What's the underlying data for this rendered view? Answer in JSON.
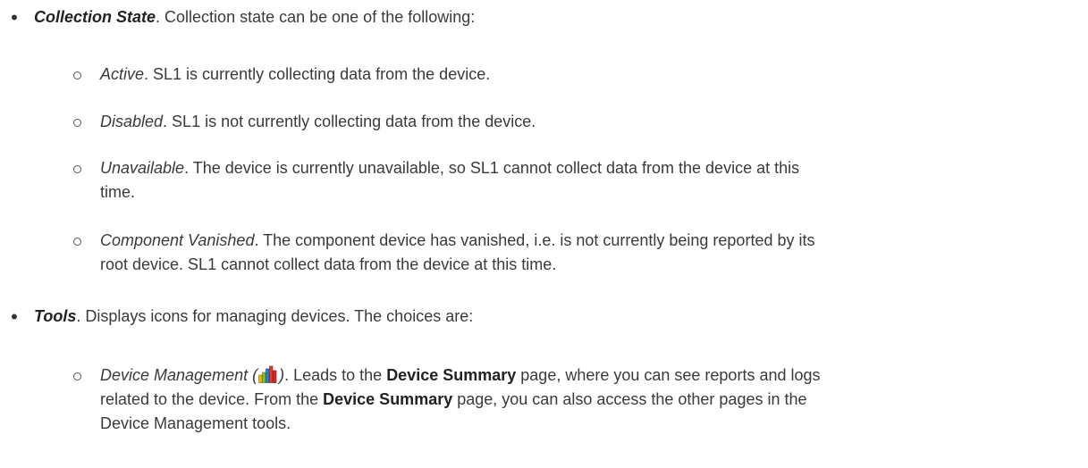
{
  "collection_state": {
    "term": "Collection State",
    "text": ". Collection state can be one of the following:",
    "items": [
      {
        "term": "Active",
        "text": ". SL1 is currently collecting data from the device."
      },
      {
        "term": "Disabled",
        "text": ". SL1 is not currently collecting data from the device."
      },
      {
        "term": "Unavailable",
        "text_line1": ". The device is currently unavailable, so SL1 cannot collect data from the device at this",
        "text_line2": "time."
      },
      {
        "term": "Component Vanished",
        "text_line1": ". The component device has vanished, i.e. is not currently being reported by its",
        "text_line2": "root device. SL1 cannot collect data from the device at this time."
      }
    ]
  },
  "tools": {
    "term": "Tools",
    "text": ". Displays icons for managing devices. The choices are:",
    "device_management": {
      "term_open": "Device Management (",
      "term_close": ")",
      "icon": "device-management-bar-chart-icon",
      "text_a": ". Leads to the ",
      "ui_label_1": "Device Summary",
      "text_b": " page, where you can see reports and logs",
      "text_line2_a": "related to the device. From the ",
      "ui_label_2": "Device Summary",
      "text_line2_b": " page, you can also access the other pages in the",
      "text_line3": "Device Management tools."
    }
  }
}
